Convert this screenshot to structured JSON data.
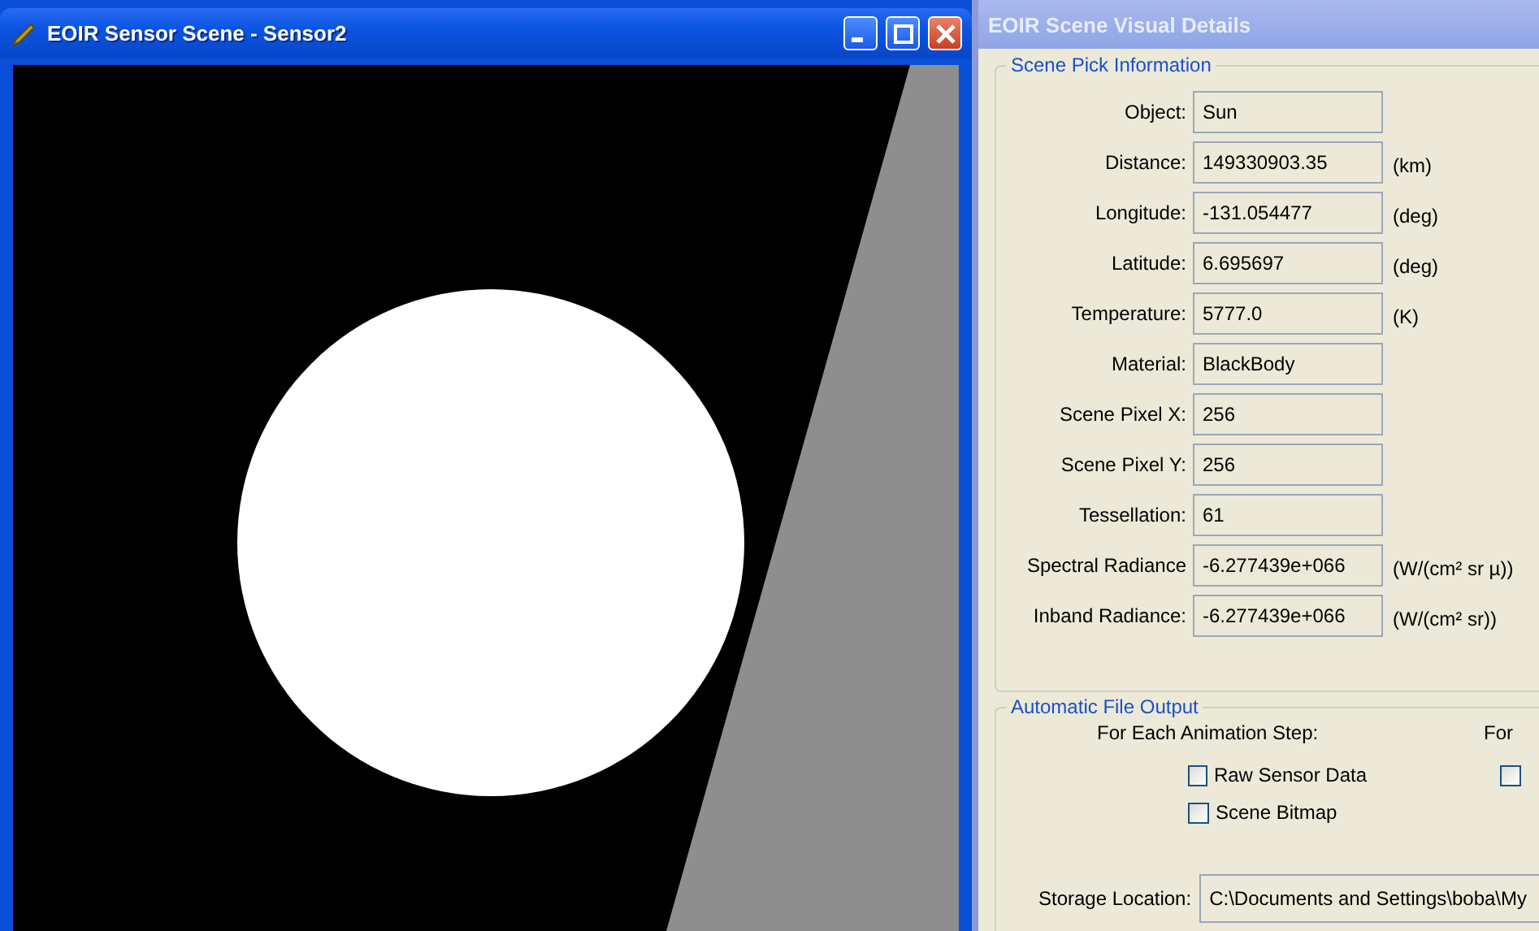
{
  "scene_window": {
    "title": "EOIR Sensor Scene - Sensor2"
  },
  "details_window": {
    "title": "EOIR Scene Visual Details",
    "scene_pick_information": {
      "title": "Scene Pick Information",
      "fields": [
        {
          "label": "Object:",
          "value": "Sun"
        },
        {
          "label": "Distance:",
          "value": "149330903.35",
          "unit": "(km)"
        },
        {
          "label": "Longitude:",
          "value": "-131.054477",
          "unit": "(deg)"
        },
        {
          "label": "Latitude:",
          "value": "6.695697",
          "unit": "(deg)"
        },
        {
          "label": "Temperature:",
          "value": "5777.0",
          "unit": "(K)"
        },
        {
          "label": "Material:",
          "value": "BlackBody"
        },
        {
          "label": "Scene Pixel X:",
          "value": "256"
        },
        {
          "label": "Scene Pixel Y:",
          "value": "256"
        },
        {
          "label": "Tessellation:",
          "value": "61"
        },
        {
          "label": "Spectral Radiance",
          "value": "-6.277439e+066",
          "unit": "(W/(cm² sr µ))"
        },
        {
          "label": "Inband Radiance:",
          "value": "-6.277439e+066",
          "unit": "(W/(cm² sr))"
        }
      ]
    },
    "automatic_file_output": {
      "title": "Automatic File Output",
      "column_1": {
        "heading": "For Each Animation Step:",
        "checkboxes": [
          {
            "label": "Raw Sensor Data",
            "checked": false
          },
          {
            "label": "Scene Bitmap",
            "checked": false
          }
        ]
      },
      "column_2": {
        "heading": "For",
        "checkboxes": [
          {
            "checked": false
          }
        ]
      },
      "storage_location": {
        "label": "Storage Location:",
        "value": "C:\\Documents and Settings\\boba\\My"
      }
    }
  }
}
